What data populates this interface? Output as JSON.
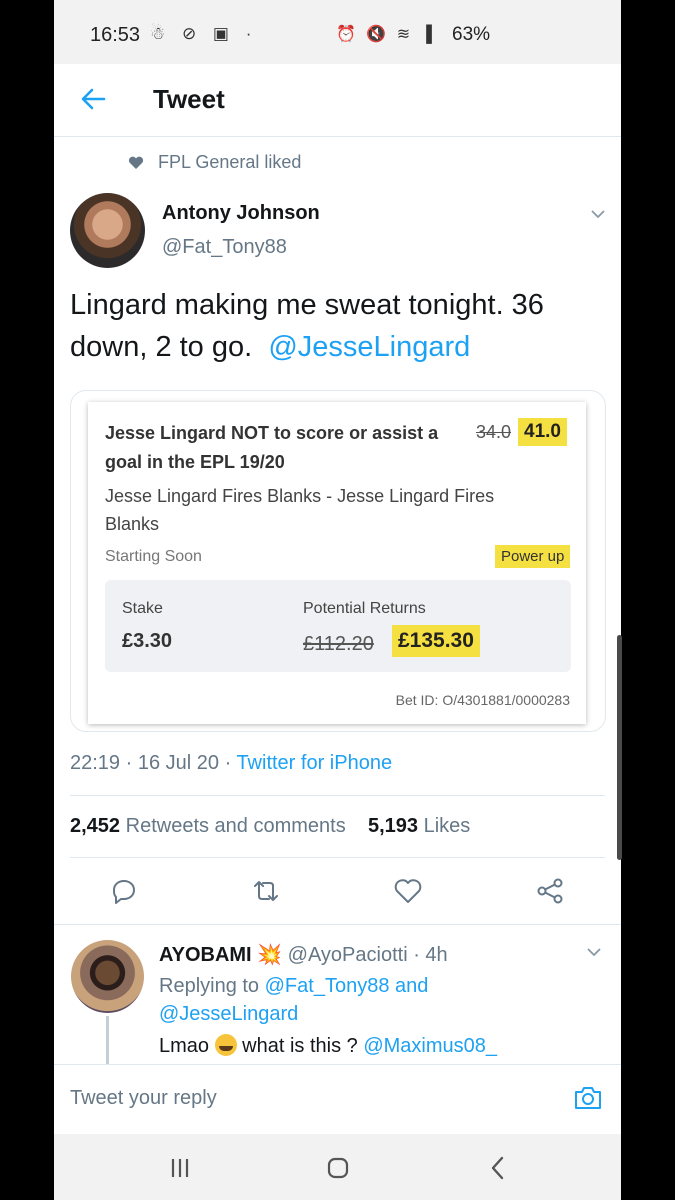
{
  "status_bar": {
    "time": "16:53",
    "left_icons": "☃ ⊘ ▣ ·",
    "right_icons": "⏰ 🔇 ≋ ▐",
    "battery": "63%"
  },
  "header": {
    "title": "Tweet"
  },
  "liked_by": "FPL General liked",
  "tweet": {
    "name": "Antony Johnson",
    "handle": "@Fat_Tony88",
    "text": "Lingard making me sweat tonight.  36 down, 2 to go.",
    "mention": "@JesseLingard",
    "time": "22:19",
    "date": "16 Jul 20",
    "source": "Twitter for iPhone",
    "retweets_count": "2,452",
    "retweets_label": "Retweets and comments",
    "likes_count": "5,193",
    "likes_label": "Likes"
  },
  "bet": {
    "title": "Jesse Lingard NOT to score or assist a goal in the EPL 19/20",
    "odds_old": "34.0",
    "odds_new": "41.0",
    "description": "Jesse Lingard Fires Blanks - Jesse Lingard Fires Blanks",
    "status": "Starting Soon",
    "badge": "Power up",
    "stake_label": "Stake",
    "stake_value": "£3.30",
    "returns_label": "Potential Returns",
    "returns_old": "£112.20",
    "returns_new": "£135.30",
    "bet_id": "Bet ID: O/4301881/0000283"
  },
  "reply": {
    "name": "AYOBAMI",
    "name_emoji": "💥",
    "handle": "@AyoPaciotti",
    "time": "4h",
    "replying_prefix": "Replying to",
    "reply_mention1": "@Fat_Tony88",
    "reply_and": "and",
    "reply_mention2": "@JesseLingard",
    "text_start": "Lmao",
    "text_mid": "what is this ?",
    "text_mention": "@Maximus08_"
  },
  "reply_bar": {
    "placeholder": "Tweet your reply"
  },
  "colors": {
    "accent": "#1da1f2",
    "highlight": "#f5e042",
    "muted": "#657786"
  },
  "icons": [
    "back-arrow-icon",
    "heart-icon",
    "chevron-down-icon",
    "reply-icon",
    "retweet-icon",
    "like-icon",
    "share-icon",
    "camera-icon",
    "recents-icon",
    "home-icon",
    "back-nav-icon"
  ]
}
